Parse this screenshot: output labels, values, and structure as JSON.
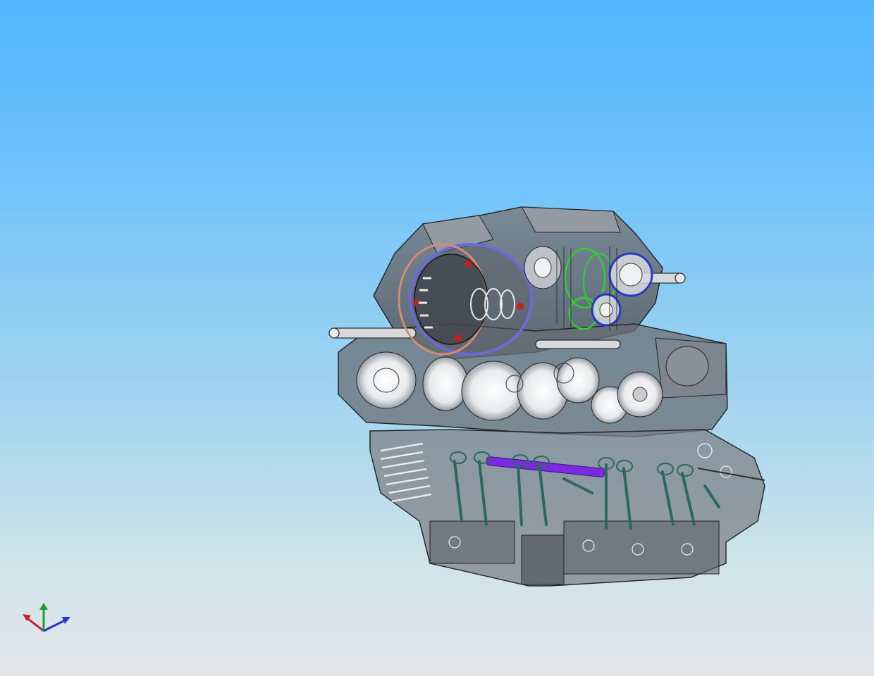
{
  "viewport": {
    "background_top": "#52b6ff",
    "background_bottom": "#e3e6e9"
  },
  "model": {
    "icon": "engine-assembly-wireframe",
    "colors": {
      "housing_fill": "#8a8f96",
      "housing_stroke": "#1e2226",
      "clutch_ring": "#d98a74",
      "clutch_disc_edge": "#6b6bd6",
      "gear_green": "#2ed12e",
      "bearing_blue": "#2a36c9",
      "valve_stem": "#2f6660",
      "camshaft": "#7a2be0",
      "bolt_red": "#c42222"
    }
  },
  "triad": {
    "icon": "xyz-axis-triad",
    "x_color": "#c0262a",
    "y_color": "#1f9c3a",
    "z_color": "#2636c8"
  }
}
